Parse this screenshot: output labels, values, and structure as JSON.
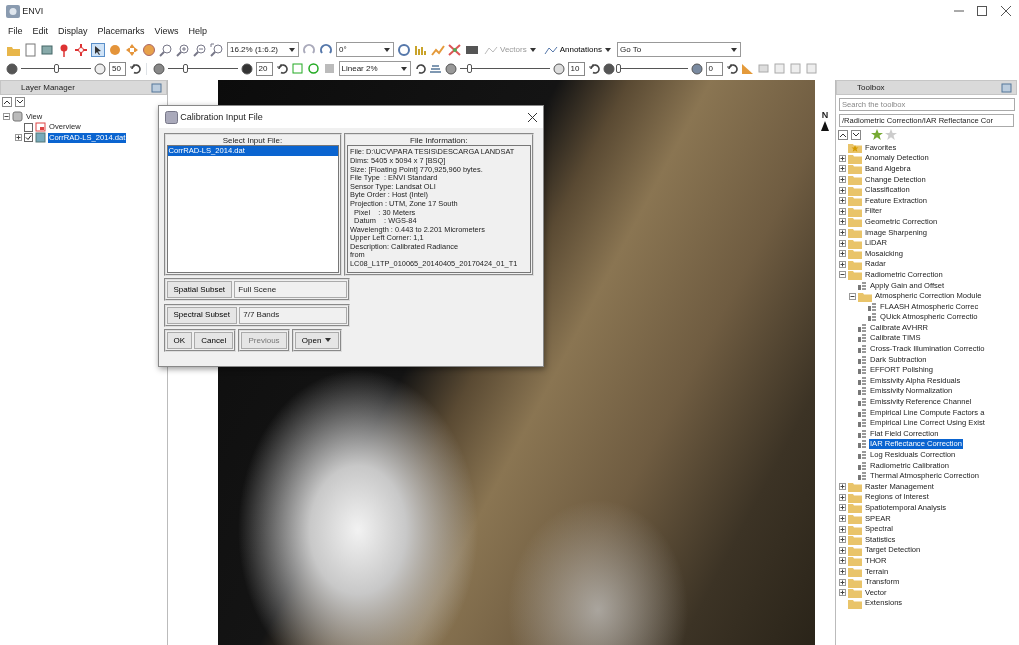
{
  "window": {
    "title": "ENVI"
  },
  "menu": [
    "File",
    "Edit",
    "Display",
    "Placemarks",
    "Views",
    "Help"
  ],
  "toolbar": {
    "zoom": "16.2% (1:6.2)",
    "rotation": "0°",
    "menus": [
      {
        "label": "Vectors",
        "disabled": true
      },
      {
        "label": "Annotations",
        "disabled": false
      }
    ],
    "goto": "Go To"
  },
  "display_bar": {
    "brightness": {
      "level": 0.5,
      "reading": "50"
    },
    "contrast": {
      "level": 0.25,
      "reading": "20"
    },
    "stretch": "Linear 2%",
    "sharpen": {
      "level": 0.1,
      "reading": "10"
    },
    "transparency": {
      "level": 0,
      "reading": "0"
    }
  },
  "layer_manager": {
    "title": "Layer Manager",
    "tree": [
      {
        "label": "View",
        "kind": "view",
        "expanded": true,
        "selected": false,
        "children": [
          {
            "label": "Overview",
            "kind": "overview",
            "checked": false,
            "selected": false
          },
          {
            "label": "CorrRAD-LS_2014.dat",
            "kind": "raster",
            "expanded": false,
            "checked": true,
            "selected": true
          }
        ]
      }
    ]
  },
  "north_arrow": "N",
  "dialog": {
    "title": "Calibration Input File",
    "select_header": "Select Input File:",
    "files": [
      {
        "label": "CorrRAD-LS_2014.dat",
        "selected": true
      }
    ],
    "info_header": "File Information:",
    "info_lines": [
      "File: D:\\UCV\\PARA TESIS\\DESCARGA LANDSAT",
      "Dims: 5405 x 5094 x 7 [BSQ]",
      "Size: [Floating Point] 770,925,960 bytes.",
      "File Type  : ENVI Standard",
      "Sensor Type: Landsat OLI",
      "Byte Order : Host (Intel)",
      "Projection : UTM, Zone 17 South",
      "  Pixel    : 30 Meters",
      "  Datum    : WGS-84",
      "Wavelength : 0.443 to 2.201 Micrometers",
      "Upper Left Corner: 1,1",
      "Description: Calibrated Radiance",
      "from",
      "LC08_L1TP_010065_20140405_20170424_01_T1"
    ],
    "subsets": [
      {
        "button": "Spatial Subset",
        "value": "Full Scene"
      },
      {
        "button": "Spectral Subset",
        "value": "7/7 Bands"
      }
    ],
    "buttons": [
      {
        "label": "OK",
        "disabled": false,
        "kind": "plain"
      },
      {
        "label": "Cancel",
        "disabled": false,
        "kind": "plain"
      },
      {
        "label": "Previous",
        "disabled": true,
        "kind": "plain"
      },
      {
        "label": "Open",
        "disabled": false,
        "kind": "menu"
      }
    ]
  },
  "toolbox": {
    "title": "Toolbox",
    "search": {
      "placeholder": "Search the toolbox"
    },
    "path": "/Radiometric Correction/IAR Reflectance Cor",
    "tree": [
      {
        "label": "Favorites",
        "kind": "favorites",
        "selected": false
      },
      {
        "label": "Anomaly Detection",
        "kind": "folder",
        "expanded": false,
        "selected": false
      },
      {
        "label": "Band Algebra",
        "kind": "folder",
        "expanded": false,
        "selected": false
      },
      {
        "label": "Change Detection",
        "kind": "folder",
        "expanded": false,
        "selected": false
      },
      {
        "label": "Classification",
        "kind": "folder",
        "expanded": false,
        "selected": false
      },
      {
        "label": "Feature Extraction",
        "kind": "folder",
        "expanded": false,
        "selected": false
      },
      {
        "label": "Filter",
        "kind": "folder",
        "expanded": false,
        "selected": false
      },
      {
        "label": "Geometric Correction",
        "kind": "folder",
        "expanded": false,
        "selected": false
      },
      {
        "label": "Image Sharpening",
        "kind": "folder",
        "expanded": false,
        "selected": false
      },
      {
        "label": "LiDAR",
        "kind": "folder",
        "expanded": false,
        "selected": false
      },
      {
        "label": "Mosaicking",
        "kind": "folder",
        "expanded": false,
        "selected": false
      },
      {
        "label": "Radar",
        "kind": "folder",
        "expanded": false,
        "selected": false
      },
      {
        "label": "Radiometric Correction",
        "kind": "folder",
        "expanded": true,
        "selected": false,
        "children": [
          {
            "label": "Apply Gain and Offset",
            "kind": "tool",
            "selected": false
          },
          {
            "label": "Atmospheric Correction Module",
            "kind": "folder",
            "expanded": true,
            "selected": false,
            "children": [
              {
                "label": "FLAASH Atmospheric Correc",
                "kind": "tool",
                "selected": false
              },
              {
                "label": "QUick Atmospheric Correctio",
                "kind": "tool",
                "selected": false
              }
            ]
          },
          {
            "label": "Calibrate AVHRR",
            "kind": "tool",
            "selected": false
          },
          {
            "label": "Calibrate TIMS",
            "kind": "tool",
            "selected": false
          },
          {
            "label": "Cross-Track Illumination Correctio",
            "kind": "tool",
            "selected": false
          },
          {
            "label": "Dark Subtraction",
            "kind": "tool",
            "selected": false
          },
          {
            "label": "EFFORT Polishing",
            "kind": "tool",
            "selected": false
          },
          {
            "label": "Emissivity Alpha Residuals",
            "kind": "tool",
            "selected": false
          },
          {
            "label": "Emissivity Normalization",
            "kind": "tool",
            "selected": false
          },
          {
            "label": "Emissivity Reference Channel",
            "kind": "tool",
            "selected": false
          },
          {
            "label": "Empirical Line Compute Factors a",
            "kind": "tool",
            "selected": false
          },
          {
            "label": "Empirical Line Correct Using Exist",
            "kind": "tool",
            "selected": false
          },
          {
            "label": "Flat Field Correction",
            "kind": "tool",
            "selected": false
          },
          {
            "label": "IAR Reflectance Correction",
            "kind": "tool",
            "selected": true
          },
          {
            "label": "Log Residuals Correction",
            "kind": "tool",
            "selected": false
          },
          {
            "label": "Radiometric Calibration",
            "kind": "tool",
            "selected": false
          },
          {
            "label": "Thermal Atmospheric Correction",
            "kind": "tool",
            "selected": false
          }
        ]
      },
      {
        "label": "Raster Management",
        "kind": "folder",
        "expanded": false,
        "selected": false
      },
      {
        "label": "Regions of Interest",
        "kind": "folder",
        "expanded": false,
        "selected": false
      },
      {
        "label": "Spatiotemporal Analysis",
        "kind": "folder",
        "expanded": false,
        "selected": false
      },
      {
        "label": "SPEAR",
        "kind": "folder",
        "expanded": false,
        "selected": false
      },
      {
        "label": "Spectral",
        "kind": "folder",
        "expanded": false,
        "selected": false
      },
      {
        "label": "Statistics",
        "kind": "folder",
        "expanded": false,
        "selected": false
      },
      {
        "label": "Target Detection",
        "kind": "folder",
        "expanded": false,
        "selected": false
      },
      {
        "label": "THOR",
        "kind": "folder",
        "expanded": false,
        "selected": false
      },
      {
        "label": "Terrain",
        "kind": "folder",
        "expanded": false,
        "selected": false
      },
      {
        "label": "Transform",
        "kind": "folder",
        "expanded": false,
        "selected": false
      },
      {
        "label": "Vector",
        "kind": "folder",
        "expanded": false,
        "selected": false
      },
      {
        "label": "Extensions",
        "kind": "folder",
        "selected": false
      }
    ]
  }
}
